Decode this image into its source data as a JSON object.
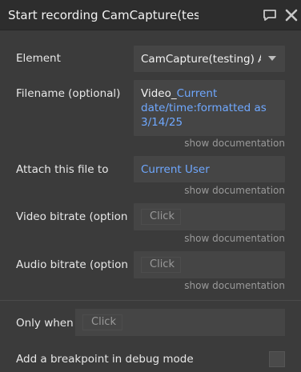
{
  "title": "Start recording CamCapture(testing)",
  "icons": {
    "comment": "comment-icon",
    "close": "close-icon",
    "dropdown": "chevron-down-icon"
  },
  "colors": {
    "dynamic_text": "#6fa8ff",
    "panel_bg": "#3b3b3b",
    "field_bg": "#454545"
  },
  "fields": {
    "element": {
      "label": "Element",
      "value": "CamCapture(testing) A"
    },
    "filename": {
      "label": "Filename (optional)",
      "static_part": "Video_",
      "dynamic_part": "Current date/time:formatted as 3/14/25",
      "doc_link": "show documentation"
    },
    "attach": {
      "label": "Attach this file to",
      "value": "Current User",
      "doc_link": "show documentation"
    },
    "video_bitrate": {
      "label": "Video bitrate (optiona",
      "placeholder": "Click",
      "doc_link": "show documentation"
    },
    "audio_bitrate": {
      "label": "Audio bitrate (optiona",
      "placeholder": "Click",
      "doc_link": "show documentation"
    }
  },
  "conditions": {
    "only_when": {
      "label": "Only when",
      "placeholder": "Click"
    },
    "breakpoint": {
      "label": "Add a breakpoint in debug mode",
      "checked": false
    }
  }
}
